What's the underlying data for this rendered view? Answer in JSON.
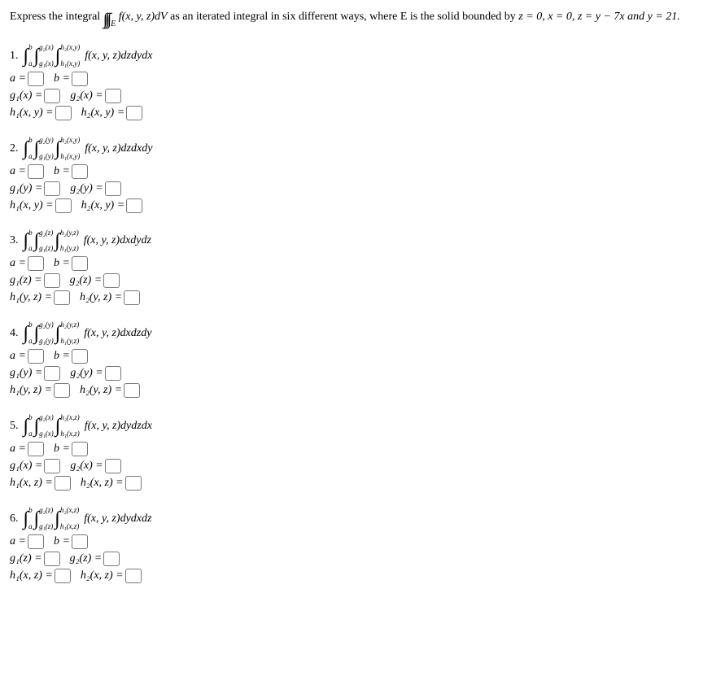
{
  "intro": {
    "prefix": "Express the integral",
    "integralTex": "f(x, y, z)dV",
    "mid": " as an iterated integral in six different ways, where E is the solid bounded by ",
    "bounds": "z = 0, x = 0, z = y − 7x and y = 21."
  },
  "problems": [
    {
      "n": "1.",
      "int_labels": {
        "o_up": "b",
        "o_lo": "a",
        "m_up": "g₂(x)",
        "m_lo": "g₁(x)",
        "i_up": "h₂(x,y)",
        "i_lo": "h₁(x,y)"
      },
      "integrand": "f(x, y, z)dzdydx",
      "lines": [
        [
          {
            "lhs": "a =",
            "in": true
          },
          {
            "lhs": "b =",
            "in": true
          }
        ],
        [
          {
            "lhs": "g₁(x) =",
            "in": true
          },
          {
            "lhs": "g₂(x) =",
            "in": true
          }
        ],
        [
          {
            "lhs": "h₁(x, y) =",
            "in": true
          },
          {
            "lhs": "h₂(x, y) =",
            "in": true
          }
        ]
      ]
    },
    {
      "n": "2.",
      "int_labels": {
        "o_up": "b",
        "o_lo": "a",
        "m_up": "g₂(y)",
        "m_lo": "g₁(y)",
        "i_up": "h₂(x,y)",
        "i_lo": "h₁(x,y)"
      },
      "integrand": "f(x, y, z)dzdxdy",
      "lines": [
        [
          {
            "lhs": "a =",
            "in": true
          },
          {
            "lhs": "b =",
            "in": true
          }
        ],
        [
          {
            "lhs": "g₁(y) =",
            "in": true
          },
          {
            "lhs": "g₂(y) =",
            "in": true
          }
        ],
        [
          {
            "lhs": "h₁(x, y) =",
            "in": true
          },
          {
            "lhs": "h₂(x, y) =",
            "in": true
          }
        ]
      ]
    },
    {
      "n": "3.",
      "int_labels": {
        "o_up": "b",
        "o_lo": "a",
        "m_up": "g₂(z)",
        "m_lo": "g₁(z)",
        "i_up": "h₂(y,z)",
        "i_lo": "h₁(y,z)"
      },
      "integrand": "f(x, y, z)dxdydz",
      "lines": [
        [
          {
            "lhs": "a =",
            "in": true
          },
          {
            "lhs": "b =",
            "in": true
          }
        ],
        [
          {
            "lhs": "g₁(z) =",
            "in": true
          },
          {
            "lhs": "g₂(z) =",
            "in": true
          }
        ],
        [
          {
            "lhs": "h₁(y, z) =",
            "in": true
          },
          {
            "lhs": "h₂(y, z) =",
            "in": true
          }
        ]
      ]
    },
    {
      "n": "4.",
      "int_labels": {
        "o_up": "b",
        "o_lo": "a",
        "m_up": "g₂(y)",
        "m_lo": "g₁(y)",
        "i_up": "h₂(y,z)",
        "i_lo": "h₁(y,z)"
      },
      "integrand": "f(x, y, z)dxdzdy",
      "lines": [
        [
          {
            "lhs": "a =",
            "in": true
          },
          {
            "lhs": "b =",
            "in": true
          }
        ],
        [
          {
            "lhs": "g₁(y) =",
            "in": true
          },
          {
            "lhs": "g₂(y) =",
            "in": true
          }
        ],
        [
          {
            "lhs": "h₁(y, z) =",
            "in": true
          },
          {
            "lhs": "h₂(y, z) =",
            "in": true
          }
        ]
      ]
    },
    {
      "n": "5.",
      "int_labels": {
        "o_up": "b",
        "o_lo": "a",
        "m_up": "g₂(x)",
        "m_lo": "g₁(x)",
        "i_up": "h₂(x,z)",
        "i_lo": "h₁(x,z)"
      },
      "integrand": "f(x, y, z)dydzdx",
      "lines": [
        [
          {
            "lhs": "a =",
            "in": true
          },
          {
            "lhs": "b =",
            "in": true
          }
        ],
        [
          {
            "lhs": "g₁(x) =",
            "in": true
          },
          {
            "lhs": "g₂(x) =",
            "in": true
          }
        ],
        [
          {
            "lhs": "h₁(x, z) =",
            "in": true
          },
          {
            "lhs": "h₂(x, z) =",
            "in": true
          }
        ]
      ]
    },
    {
      "n": "6.",
      "int_labels": {
        "o_up": "b",
        "o_lo": "a",
        "m_up": "g₂(z)",
        "m_lo": "g₁(z)",
        "i_up": "h₂(x,z)",
        "i_lo": "h₁(x,z)"
      },
      "integrand": "f(x, y, z)dydxdz",
      "lines": [
        [
          {
            "lhs": "a =",
            "in": true
          },
          {
            "lhs": "b =",
            "in": true
          }
        ],
        [
          {
            "lhs": "g₁(z) =",
            "in": true
          },
          {
            "lhs": "g₂(z) =",
            "in": true
          }
        ],
        [
          {
            "lhs": "h₁(x, z) =",
            "in": true
          },
          {
            "lhs": "h₂(x, z) =",
            "in": true
          }
        ]
      ]
    }
  ]
}
